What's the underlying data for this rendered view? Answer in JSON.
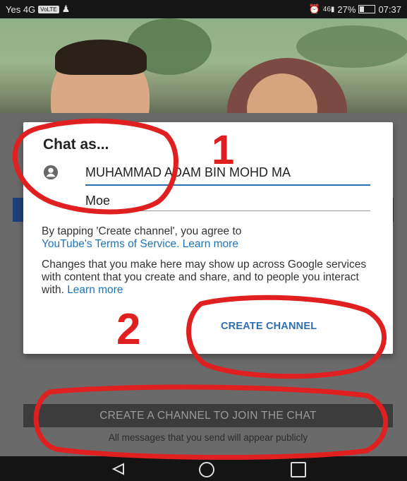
{
  "status_bar": {
    "carrier": "Yes 4G",
    "volte": "VoLTE",
    "signal": "46",
    "battery": "27%",
    "time": "07:37"
  },
  "dialog": {
    "title": "Chat as...",
    "name_value": "MUHAMMAD ADAM BIN MOHD MA",
    "handle_value": "Moe",
    "terms_text": "By tapping 'Create channel', you agree to",
    "terms_link": "YouTube's Terms of Service.",
    "terms_learn_more": "Learn more",
    "changes_text": "Changes that you make here may show up across Google services with content that you create and share, and to people you interact with.",
    "changes_learn_more": "Learn more",
    "create_button": "CREATE CHANNEL"
  },
  "chat": {
    "join_button": "CREATE A CHANNEL TO JOIN THE CHAT",
    "public_note": "All messages that you send will appear publicly"
  },
  "annotations": {
    "label_1": "1",
    "label_2": "2",
    "color": "#e02020"
  },
  "icons": [
    "person-icon",
    "nav-back-icon",
    "nav-home-icon",
    "nav-recents-icon",
    "alarm-icon",
    "signal-icon",
    "battery-icon"
  ]
}
